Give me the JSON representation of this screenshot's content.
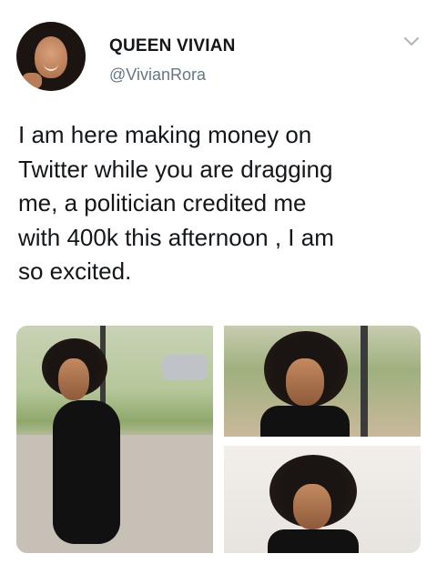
{
  "user": {
    "display_name": "QUEEN VIVIAN",
    "handle": "@VivianRora"
  },
  "tweet": {
    "text": "I am here making money on\nTwitter while you are dragging\nme, a politician credited me\nwith 400k this afternoon , I am\nso excited."
  },
  "icons": {
    "avatar": "avatar-photo",
    "more": "chevron-down-icon"
  },
  "media": {
    "photo_count": 3
  },
  "colors": {
    "name": "#14171a",
    "handle": "#657786",
    "text": "#14171a",
    "chevron": "#aab8c2"
  }
}
